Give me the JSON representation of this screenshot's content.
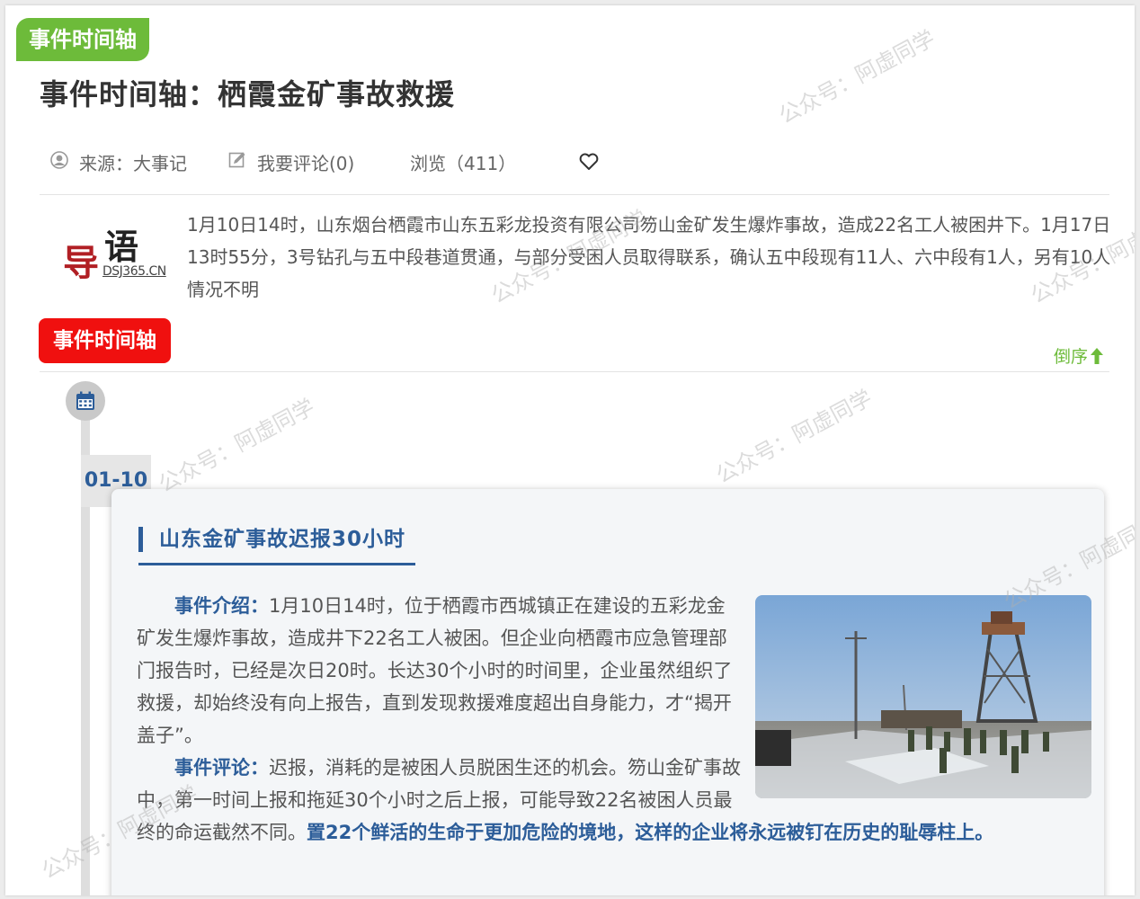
{
  "header": {
    "top_tab": "事件时间轴",
    "title": "事件时间轴：栖霞金矿事故救援"
  },
  "meta": {
    "source": "来源：大事记",
    "comment": "我要评论(0)",
    "views": "浏览（411）",
    "favorite_icon": "heart-icon"
  },
  "logo": {
    "char1": "导",
    "char2": "语",
    "domain": "DSJ365.CN"
  },
  "intro": "1月10日14时，山东烟台栖霞市山东五彩龙投资有限公司笏山金矿发生爆炸事故，造成22名工人被困井下。1月17日13时55分，3号钻孔与五中段巷道贯通，与部分受困人员取得联系，确认五中段现有11人、六中段有1人，另有10人情况不明",
  "timeline": {
    "section_tab": "事件时间轴",
    "sort_label": "倒序",
    "entry": {
      "date": "01-10",
      "title": "山东金矿事故迟报30小时",
      "intro_label": "事件介绍：",
      "intro_text": "1月10日14时，位于栖霞市西城镇正在建设的五彩龙金矿发生爆炸事故，造成井下22名工人被困。但企业向栖霞市应急管理部门报告时，已经是次日20时。长达30个小时的时间里，企业虽然组织了救援，却始终没有向上报告，直到发现救援难度超出自身能力，才“揭开盖子”。",
      "comment_label": "事件评论：",
      "comment_text": "迟报，消耗的是被困人员脱困生还的机会。笏山金矿事故中，第一时间上报和拖延30个小时之后上报，可能导致22名被困人员最终的命运截然不同。",
      "comment_emphasis": "置22个鲜活的生命于更加危险的境地，这样的企业将永远被钉在历史的耻辱柱上。"
    }
  },
  "watermark": "公众号：阿虚同学",
  "colors": {
    "green": "#6dbb3a",
    "red": "#f0100f",
    "blue": "#2c5d99"
  }
}
